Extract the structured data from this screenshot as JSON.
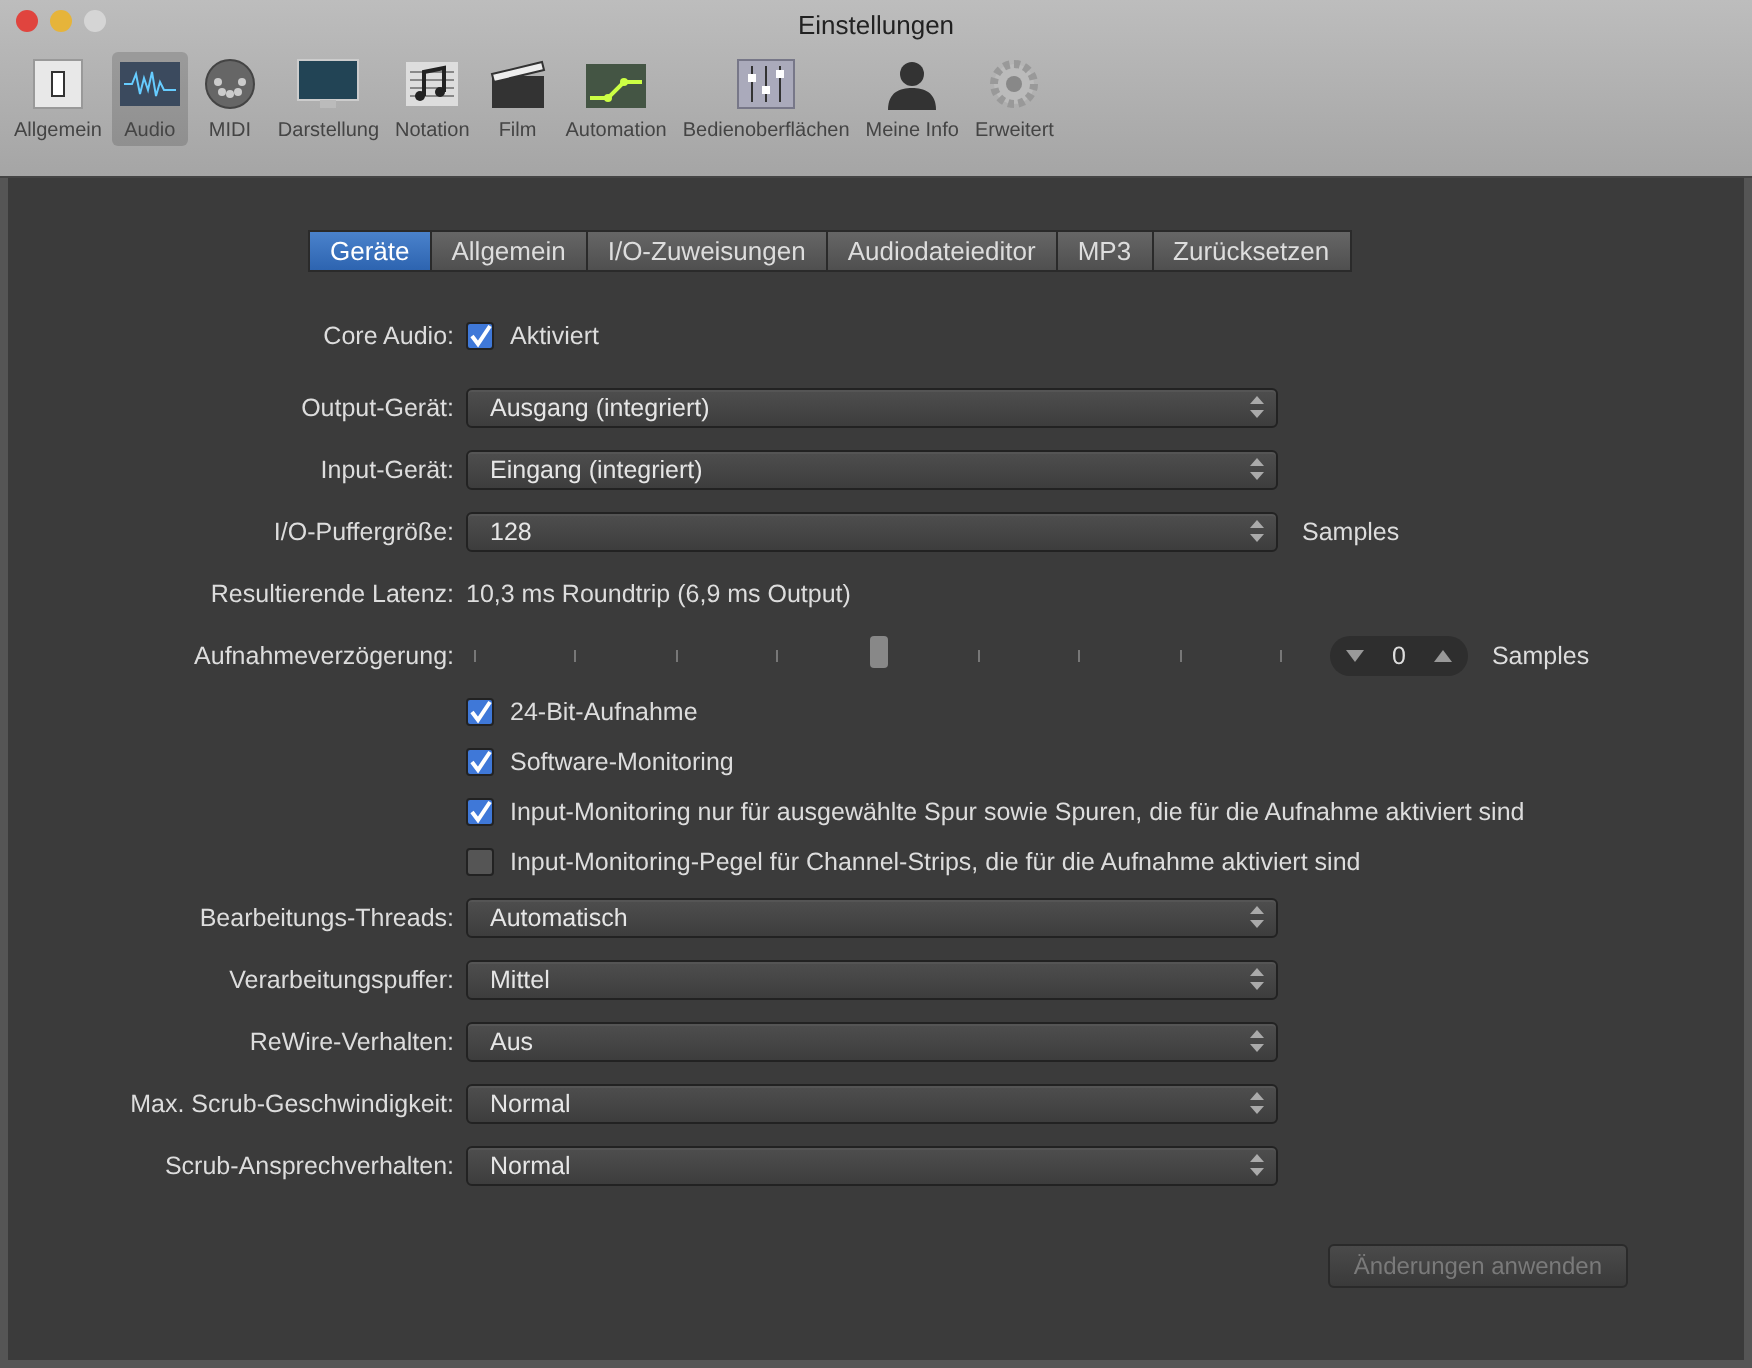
{
  "window": {
    "title": "Einstellungen"
  },
  "toolbar": [
    {
      "label": "Allgemein",
      "kind": "switch",
      "selected": false
    },
    {
      "label": "Audio",
      "kind": "waveform",
      "selected": true
    },
    {
      "label": "MIDI",
      "kind": "connector",
      "selected": false
    },
    {
      "label": "Darstellung",
      "kind": "monitor",
      "selected": false
    },
    {
      "label": "Notation",
      "kind": "notes",
      "selected": false
    },
    {
      "label": "Film",
      "kind": "clapper",
      "selected": false
    },
    {
      "label": "Automation",
      "kind": "automation",
      "selected": false
    },
    {
      "label": "Bedienoberflächen",
      "kind": "faders",
      "selected": false
    },
    {
      "label": "Meine Info",
      "kind": "person",
      "selected": false
    },
    {
      "label": "Erweitert",
      "kind": "gear",
      "selected": false
    }
  ],
  "tabs": [
    {
      "label": "Geräte",
      "selected": true
    },
    {
      "label": "Allgemein",
      "selected": false
    },
    {
      "label": "I/O-Zuweisungen",
      "selected": false
    },
    {
      "label": "Audiodateieditor",
      "selected": false
    },
    {
      "label": "MP3",
      "selected": false
    },
    {
      "label": "Zurücksetzen",
      "selected": false
    }
  ],
  "rows": [
    {
      "kind": "checkbox",
      "label": "Core Audio:",
      "text": "Aktiviert",
      "checked": true
    },
    {
      "kind": "popup",
      "label": "Output-Gerät:",
      "value": "Ausgang (integriert)"
    },
    {
      "kind": "popup",
      "label": "Input-Gerät:",
      "value": "Eingang (integriert)"
    },
    {
      "kind": "popup",
      "label": "I/O-Puffergröße:",
      "value": "128",
      "unit": "Samples"
    },
    {
      "kind": "text",
      "label": "Resultierende Latenz:",
      "value": "10,3 ms Roundtrip (6,9 ms Output)"
    },
    {
      "kind": "slider",
      "label": "Aufnahmeverzögerung:",
      "level": 0.5,
      "value": "0",
      "unit": "Samples"
    },
    {
      "kind": "checkbox",
      "text": "24-Bit-Aufnahme",
      "checked": true
    },
    {
      "kind": "checkbox",
      "text": "Software-Monitoring",
      "checked": true
    },
    {
      "kind": "checkbox",
      "text": "Input-Monitoring nur für ausgewählte Spur sowie Spuren, die für die Aufnahme aktiviert sind",
      "checked": true
    },
    {
      "kind": "checkbox",
      "text": "Input-Monitoring-Pegel für Channel-Strips, die für die Aufnahme aktiviert sind",
      "checked": false
    },
    {
      "kind": "popup",
      "label": "Bearbeitungs-Threads:",
      "value": "Automatisch"
    },
    {
      "kind": "popup",
      "label": "Verarbeitungspuffer:",
      "value": "Mittel"
    },
    {
      "kind": "popup",
      "label": "ReWire-Verhalten:",
      "value": "Aus"
    },
    {
      "kind": "popup",
      "label": "Max. Scrub-Geschwindigkeit:",
      "value": "Normal"
    },
    {
      "kind": "popup",
      "label": "Scrub-Ansprechverhalten:",
      "value": "Normal"
    }
  ],
  "footer_button": {
    "label": "Änderungen anwenden",
    "disabled": true
  }
}
